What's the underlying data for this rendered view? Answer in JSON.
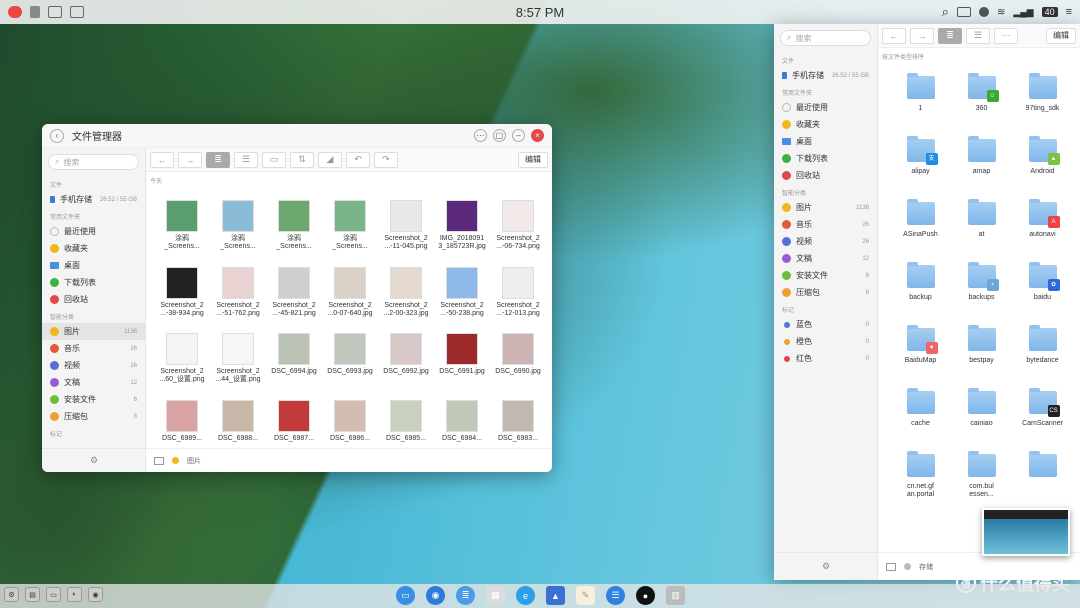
{
  "topbar": {
    "clock": "8:57 PM",
    "battery": "40"
  },
  "fm1": {
    "title": "文件管理器",
    "search_placeholder": "搜索",
    "sections": {
      "files": "文件",
      "common": "常用文件夹",
      "smart": "智能分类",
      "tags": "标记"
    },
    "storage": {
      "label": "手机存储",
      "size": "26.52 / 55 GB"
    },
    "common": [
      "最近使用",
      "收藏夹",
      "桌面",
      "下载列表",
      "回收站"
    ],
    "smart": [
      {
        "label": "图片",
        "count": "1136"
      },
      {
        "label": "音乐",
        "count": "26"
      },
      {
        "label": "视频",
        "count": "26"
      },
      {
        "label": "文稿",
        "count": "12"
      },
      {
        "label": "安装文件",
        "count": "6"
      },
      {
        "label": "压缩包",
        "count": "8"
      }
    ],
    "edit": "编辑",
    "date_header": "今天",
    "files": [
      {
        "name": "涂鸦\n_Screens...",
        "color": "#5a9e6f"
      },
      {
        "name": "涂鸦\n_Screens...",
        "color": "#8bbbd6"
      },
      {
        "name": "涂鸦\n_Screens...",
        "color": "#6da96f"
      },
      {
        "name": "涂鸦\n_Screens...",
        "color": "#7cb48a"
      },
      {
        "name": "Screenshot_2\n...-11-045.png",
        "color": "#e8e8e8"
      },
      {
        "name": "IMG_2018091\n3_185723R.jpg",
        "color": "#5b2a7d"
      },
      {
        "name": "Screenshot_2\n...-06-734.png",
        "color": "#f2e9e9"
      },
      {
        "name": "Screenshot_2\n...-38-934.png",
        "color": "#222222"
      },
      {
        "name": "Screenshot_2\n...-51-762.png",
        "color": "#e9d2d2"
      },
      {
        "name": "Screenshot_2\n...-45-821.png",
        "color": "#cfcfcf"
      },
      {
        "name": "Screenshot_2\n...0-07-640.jpg",
        "color": "#d9d0c8"
      },
      {
        "name": "Screenshot_2\n...2-00-323.jpg",
        "color": "#e4d9cf"
      },
      {
        "name": "Screenshot_2\n...-50-238.png",
        "color": "#8fb9e8"
      },
      {
        "name": "Screenshot_2\n...-12-013.png",
        "color": "#eeeeee"
      },
      {
        "name": "Screenshot_2\n...60_设置.png",
        "color": "#f4f4f4"
      },
      {
        "name": "Screenshot_2\n...44_设置.png",
        "color": "#f6f6f6"
      },
      {
        "name": "DSC_6994.jpg",
        "color": "#b9c2b4"
      },
      {
        "name": "DSC_6993.jpg",
        "color": "#c2c7bd"
      },
      {
        "name": "DSC_6992.jpg",
        "color": "#d8c8c8"
      },
      {
        "name": "DSC_6991.jpg",
        "color": "#9c2a2a"
      },
      {
        "name": "DSC_6990.jpg",
        "color": "#cdb4b4"
      },
      {
        "name": "DSC_6989...",
        "color": "#d9a3a3"
      },
      {
        "name": "DSC_6988...",
        "color": "#c9b7a8"
      },
      {
        "name": "DSC_6987...",
        "color": "#c23b3b"
      },
      {
        "name": "DSC_6986...",
        "color": "#d4bcb2"
      },
      {
        "name": "DSC_6985...",
        "color": "#c8d0c0"
      },
      {
        "name": "DSC_6984...",
        "color": "#c0c8b8"
      },
      {
        "name": "DSC_6983...",
        "color": "#bfb9b0"
      }
    ],
    "status": "图片"
  },
  "fm2": {
    "search_placeholder": "搜索",
    "sections": {
      "files": "文件",
      "common": "常用文件夹",
      "smart": "智能分类",
      "tags": "标记"
    },
    "storage": {
      "label": "手机存储",
      "size": "26.52 / 55 GB"
    },
    "common": [
      "最近使用",
      "收藏夹",
      "桌面",
      "下载列表",
      "回收站"
    ],
    "smart": [
      {
        "label": "图片",
        "count": "1136"
      },
      {
        "label": "音乐",
        "count": "26"
      },
      {
        "label": "视频",
        "count": "26"
      },
      {
        "label": "文稿",
        "count": "12"
      },
      {
        "label": "安装文件",
        "count": "6"
      },
      {
        "label": "压缩包",
        "count": "8"
      }
    ],
    "tags": [
      {
        "label": "蓝色",
        "count": "0",
        "color": "#4a7bd0"
      },
      {
        "label": "橙色",
        "count": "0",
        "color": "#f0a030"
      },
      {
        "label": "红色",
        "count": "0",
        "color": "#e04848"
      }
    ],
    "edit": "编辑",
    "hint": "按文件类型排序",
    "status": "存储",
    "folders": [
      {
        "name": "1",
        "badge": "",
        "badge_color": ""
      },
      {
        "name": "360",
        "badge": "☺",
        "badge_color": "#3aa832"
      },
      {
        "name": "97ting_sdk",
        "badge": "",
        "badge_color": ""
      },
      {
        "name": "alipay",
        "badge": "支",
        "badge_color": "#1a8fe3"
      },
      {
        "name": "amap",
        "badge": "",
        "badge_color": ""
      },
      {
        "name": "Android",
        "badge": "▲",
        "badge_color": "#7cc143"
      },
      {
        "name": "ASinaPush",
        "badge": "",
        "badge_color": ""
      },
      {
        "name": "at",
        "badge": "",
        "badge_color": ""
      },
      {
        "name": "autonavi",
        "badge": "A",
        "badge_color": "#e44"
      },
      {
        "name": "backup",
        "badge": "",
        "badge_color": ""
      },
      {
        "name": "backups",
        "badge": "▪",
        "badge_color": "#6aa7d8"
      },
      {
        "name": "baidu",
        "badge": "✿",
        "badge_color": "#2f6ad8"
      },
      {
        "name": "BaiduMap",
        "badge": "♥",
        "badge_color": "#e66"
      },
      {
        "name": "bestpay",
        "badge": "",
        "badge_color": ""
      },
      {
        "name": "bytedance",
        "badge": "",
        "badge_color": ""
      },
      {
        "name": "cache",
        "badge": "",
        "badge_color": ""
      },
      {
        "name": "cainiao",
        "badge": "",
        "badge_color": ""
      },
      {
        "name": "CamScanner",
        "badge": "CS",
        "badge_color": "#222"
      },
      {
        "name": "cn.net.gf\nan.portal",
        "badge": "",
        "badge_color": ""
      },
      {
        "name": "com.bul\nessen...",
        "badge": "",
        "badge_color": ""
      },
      {
        "name": "",
        "badge": "",
        "badge_color": ""
      }
    ]
  },
  "watermark": "什么值得买",
  "watermark_icon": "值"
}
